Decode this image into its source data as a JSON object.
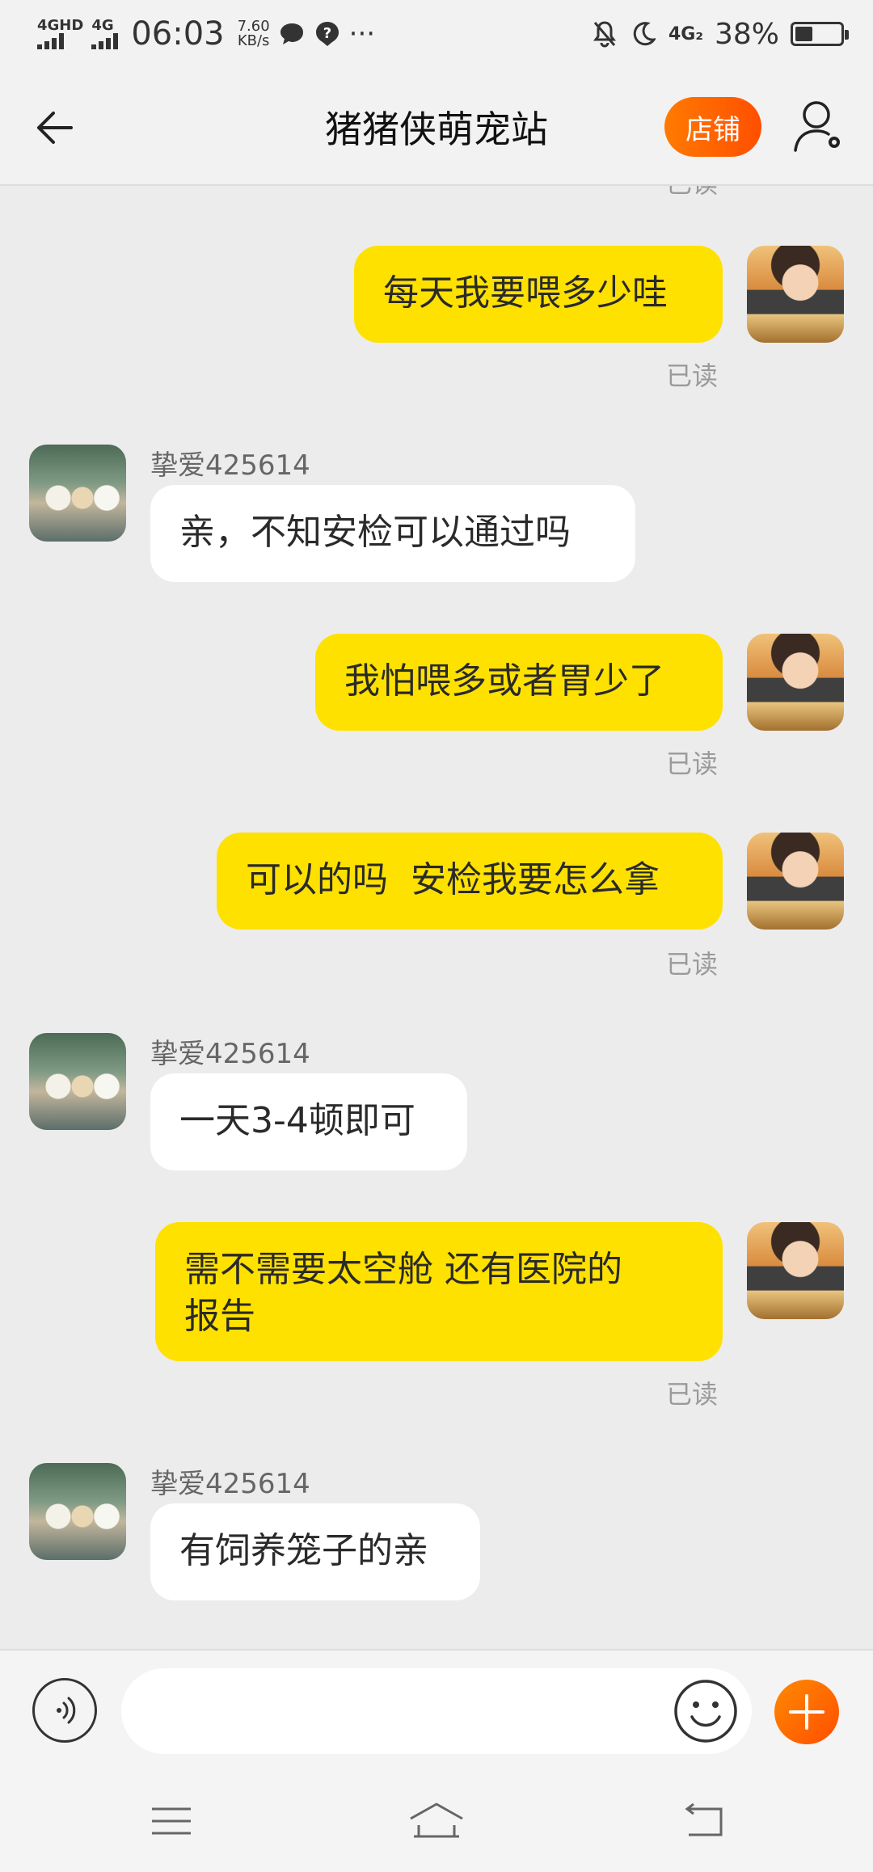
{
  "status_bar": {
    "network1": "4GHD",
    "network2": "4G",
    "time": "06:03",
    "speed_value": "7.60",
    "speed_unit": "KB/s",
    "more": "···",
    "network_right": "4G₂",
    "battery_text": "38%",
    "battery_level": 0.38
  },
  "header": {
    "title": "猪猪侠萌宠站",
    "shop_label": "店铺"
  },
  "messages": [
    {
      "from": "me",
      "text": "每天我要喂多少哇",
      "read": "已读"
    },
    {
      "from": "seller",
      "sender": "挚爱425614",
      "text": "亲，不知安检可以通过吗"
    },
    {
      "from": "me",
      "text": "我怕喂多或者胃少了",
      "read": "已读"
    },
    {
      "from": "me",
      "text": "可以的吗  安检我要怎么拿",
      "read": "已读"
    },
    {
      "from": "seller",
      "sender": "挚爱425614",
      "text": "一天3-4顿即可"
    },
    {
      "from": "me",
      "text": "需不需要太空舱 还有医院的\n报告",
      "read": "已读"
    },
    {
      "from": "seller",
      "sender": "挚爱425614",
      "text": "有饲养笼子的亲"
    }
  ],
  "top_partial_read": "已读",
  "input": {
    "value": "",
    "placeholder": ""
  },
  "colors": {
    "accent": "#ff5a00",
    "bubble_me": "#ffe100",
    "bubble_other": "#ffffff",
    "background": "#ececec"
  }
}
